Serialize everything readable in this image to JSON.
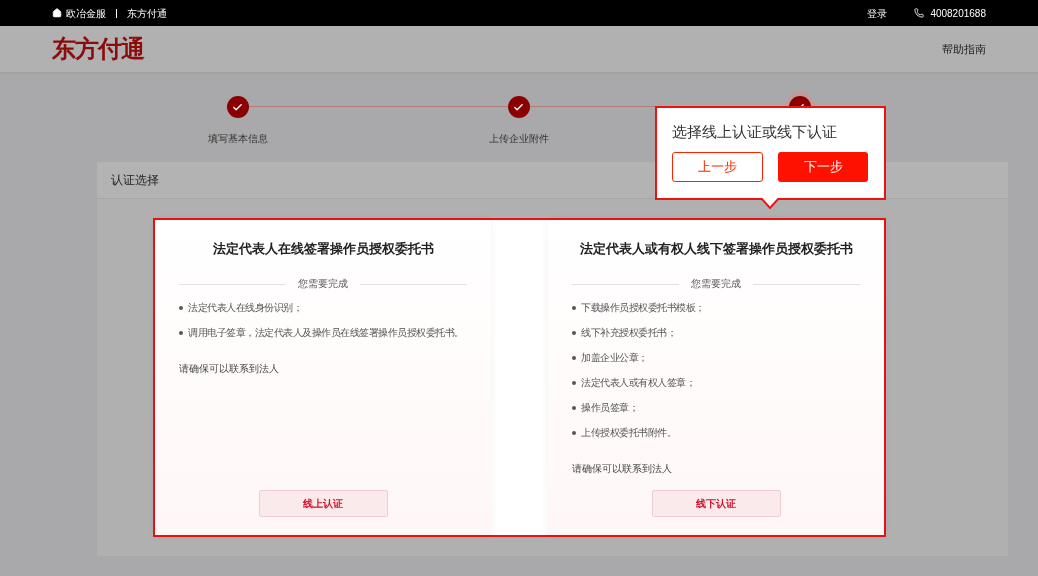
{
  "topbar": {
    "home": "欧冶金服",
    "brand": "东方付通",
    "login": "登录",
    "phone": "4008201688"
  },
  "header": {
    "logo": "东方付通",
    "help": "帮助指南"
  },
  "steps": [
    {
      "label": "填写基本信息",
      "current": false
    },
    {
      "label": "上传企业附件",
      "current": false
    },
    {
      "current": true
    }
  ],
  "panel": {
    "title": "认证选择",
    "options": [
      {
        "title": "法定代表人在线签署操作员授权委托书",
        "subtitle": "您需要完成",
        "items": [
          "法定代表人在线身份识别；",
          "调用电子签章，法定代表人及操作员在线签署操作员授权委托书。"
        ],
        "note": "请确保可以联系到法人",
        "button": "线上认证"
      },
      {
        "title": "法定代表人或有权人线下签署操作员授权委托书",
        "subtitle": "您需要完成",
        "items": [
          "下载操作员授权委托书模板；",
          "线下补充授权委托书；",
          "加盖企业公章；",
          "法定代表人或有权人签章；",
          "操作员签章；",
          "上传授权委托书附件。"
        ],
        "note": "请确保可以联系到法人",
        "button": "线下认证"
      }
    ]
  },
  "tour": {
    "text": "选择线上认证或线下认证",
    "buttons": [
      {
        "label": "上一步",
        "primary": false
      },
      {
        "label": "下一步",
        "primary": true
      }
    ]
  }
}
